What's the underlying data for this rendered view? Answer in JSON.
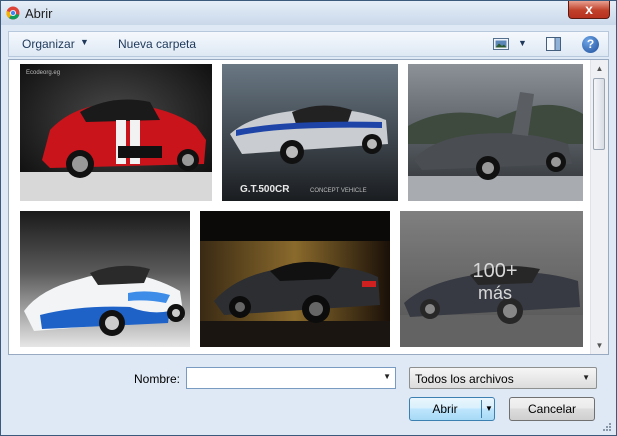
{
  "window": {
    "title": "Abrir",
    "close_label": "x",
    "app_icon": "chrome-icon"
  },
  "toolbar": {
    "organize_label": "Organizar",
    "new_folder_label": "Nueva carpeta",
    "view_icon": "views-icon",
    "preview_icon": "preview-pane-icon",
    "help_label": "?"
  },
  "thumbnails": [
    {
      "name": "red-mustang-shelby",
      "watermark": "Ecodeorg.eg"
    },
    {
      "name": "silver-gt500cr",
      "caption": "G.T.500CR",
      "subcaption": "CONCEPT VEHICLE"
    },
    {
      "name": "gray-concept-supercar"
    },
    {
      "name": "white-blue-tuned-coupe"
    },
    {
      "name": "dark-lamborghini-sesto"
    },
    {
      "name": "black-lamborghini-gallardo",
      "overlay_count": "100+",
      "overlay_more": "más"
    }
  ],
  "footer": {
    "name_label": "Nombre:",
    "name_value": "",
    "filter_value": "Todos los archivos",
    "open_label": "Abrir",
    "cancel_label": "Cancelar"
  },
  "colors": {
    "window_bg": "#dfe9f5",
    "title_close": "#c0402a",
    "open_button": "#bee6fd"
  }
}
